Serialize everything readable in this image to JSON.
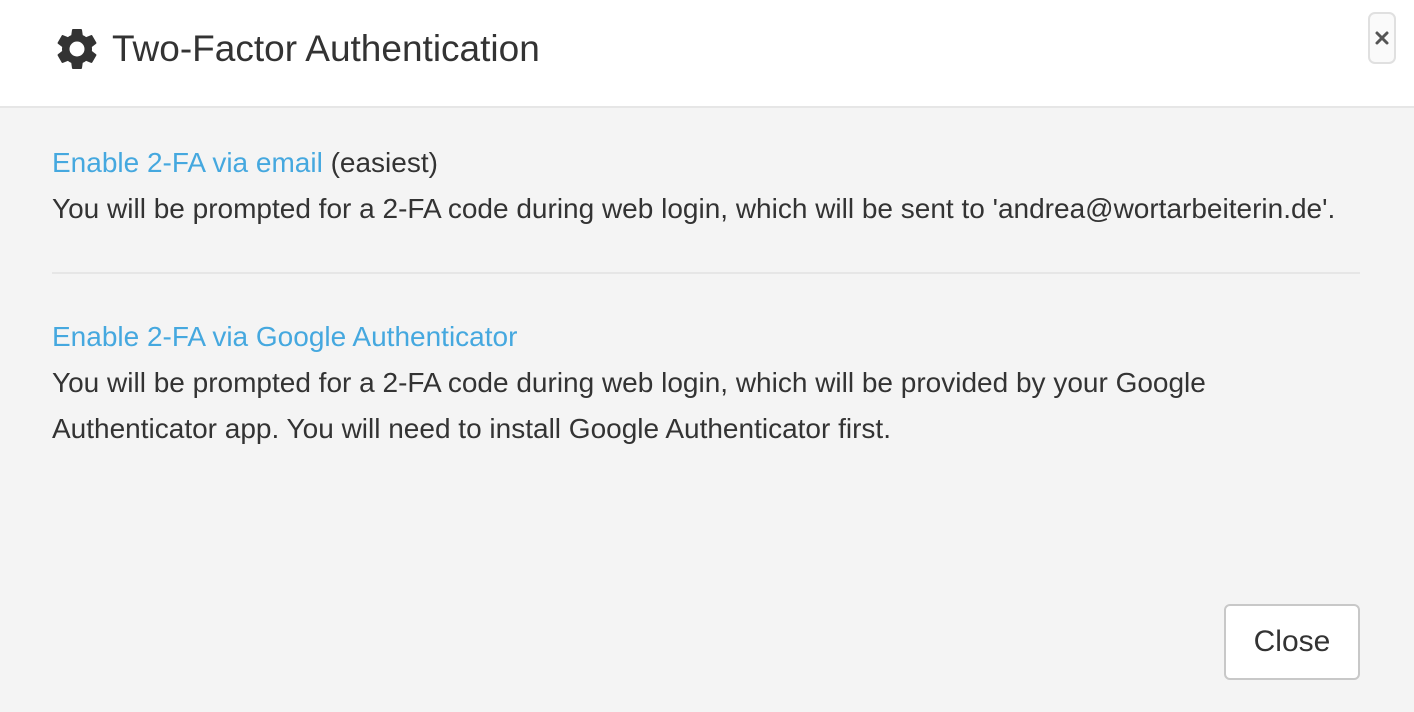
{
  "header": {
    "title": "Two-Factor Authentication",
    "icon": "gear-icon",
    "close_icon": "close-icon"
  },
  "options": [
    {
      "link_label": "Enable 2-FA via email",
      "suffix": " (easiest)",
      "description": "You will be prompted for a 2-FA code during web login, which will be sent to 'andrea@wortarbeiterin.de'."
    },
    {
      "link_label": "Enable 2-FA via Google Authenticator",
      "suffix": "",
      "description": "You will be prompted for a 2-FA code during web login, which will be provided by your Google Authenticator app. You will need to install Google Authenticator first."
    }
  ],
  "footer": {
    "close_label": "Close"
  },
  "colors": {
    "link": "#45a8df",
    "text": "#333333",
    "body_background": "#f4f4f4",
    "header_background": "#ffffff"
  }
}
